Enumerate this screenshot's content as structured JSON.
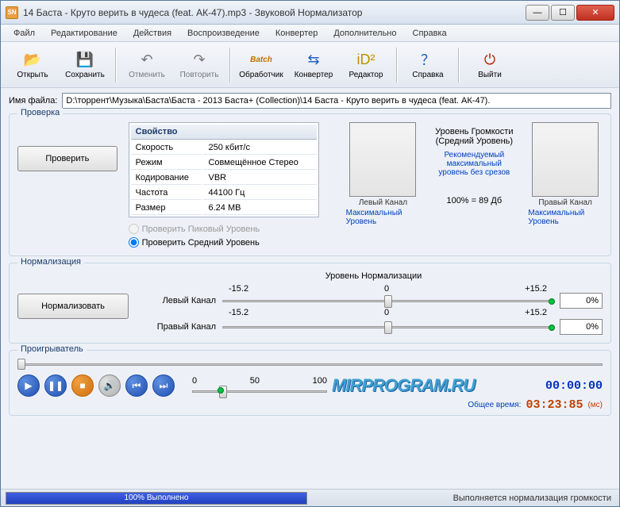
{
  "window": {
    "title": "14 Баста - Круто верить в чудеса (feat. АК-47).mp3 - Звуковой Нормализатор",
    "app_short": "SN"
  },
  "menu": {
    "file": "Файл",
    "edit": "Редактирование",
    "actions": "Действия",
    "playback": "Воспроизведение",
    "converter": "Конвертер",
    "extra": "Дополнительно",
    "help": "Справка"
  },
  "toolbar": {
    "open": "Открыть",
    "save": "Сохранить",
    "undo": "Отменить",
    "redo": "Повторить",
    "batch": "Обработчик",
    "batch_top": "Batch",
    "converter": "Конвертер",
    "editor": "Редактор",
    "help": "Справка",
    "exit": "Выйти"
  },
  "filename": {
    "label": "Имя файла:",
    "value": "D:\\торрент\\Музыка\\Баста\\Баста - 2013 Баста+ (Collection)\\14 Баста - Круто верить в чудеса (feat. АК-47)."
  },
  "check": {
    "title": "Проверка",
    "button": "Проверить",
    "prop_header": "Свойство",
    "rows": {
      "speed_k": "Скорость",
      "speed_v": "250 кбит/с",
      "mode_k": "Режим",
      "mode_v": "Совмещённое Стерео",
      "enc_k": "Кодирование",
      "enc_v": "VBR",
      "freq_k": "Частота",
      "freq_v": "44100 Гц",
      "size_k": "Размер",
      "size_v": "6.24 МВ"
    },
    "radio_peak": "Проверить Пиковый Уровень",
    "radio_avg": "Проверить Средний Уровень",
    "vol_title1": "Уровень Громкости",
    "vol_title2": "(Средний Уровень)",
    "vol_hint1": "Рекомендуемый",
    "vol_hint2": "максимальный",
    "vol_hint3": "уровень без срезов",
    "left_ch": "Левый Канал",
    "right_ch": "Правый Канал",
    "max_level": "Максимальный Уровень",
    "pct_db": "100%  =  89 Дб"
  },
  "norm": {
    "title": "Нормализация",
    "button": "Нормализовать",
    "slider_title": "Уровень Нормализации",
    "left_ch": "Левый Канал",
    "right_ch": "Правый Канал",
    "tick_lo": "-15.2",
    "tick_mid": "0",
    "tick_hi": "+15.2",
    "pct": "0%"
  },
  "player": {
    "title": "Проигрыватель",
    "t0": "0",
    "t50": "50",
    "t100": "100",
    "time_now": "00:00:00",
    "total_label": "Общее время:",
    "total_time": "03:23:85",
    "ms": "(мс)"
  },
  "watermark": "MIRPROGRAM.RU",
  "status": {
    "progress": "100% Выполнено",
    "text": "Выполняется нормализация громкости"
  }
}
